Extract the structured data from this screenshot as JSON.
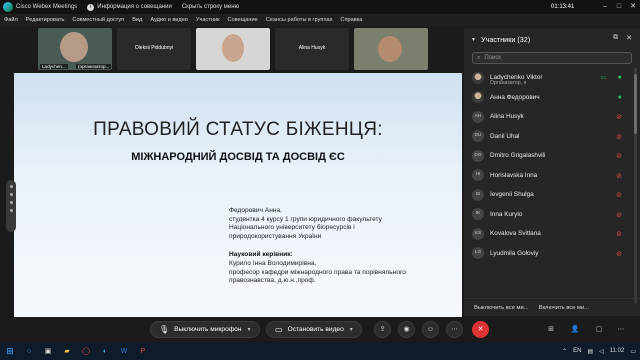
{
  "window": {
    "app_title": "Cisco Webex Meetings",
    "info_label": "Информация о совещании",
    "hide_menu_label": "Скрыть строку меню",
    "clock": "01:13:41"
  },
  "menu": [
    "Файл",
    "Редактировать",
    "Совместный доступ",
    "Вид",
    "Аудио и видео",
    "Участник",
    "Совещание",
    "Сеансы работы в группах",
    "Справка"
  ],
  "video_strip": {
    "tiles": [
      {
        "name": "Ladychen...",
        "org": "(организатор..."
      },
      {
        "name": "Oleksii Piddubnyi"
      },
      {
        "name": ""
      },
      {
        "name": "Alina Husyk"
      },
      {
        "name": ""
      }
    ]
  },
  "slide": {
    "title": "ПРАВОВИЙ СТАТУС БІЖЕНЦЯ:",
    "subtitle": "МІЖНАРОДНИЙ ДОСВІД ТА ДОСВІД ЄС",
    "author_lines": [
      "Федорович Анна,",
      "студентка 4 курсу 1 групи юридичного факультету",
      "Національного університету біоресурсів і",
      "природокористування України"
    ],
    "supervisor_label": "Науковий керівник:",
    "supervisor_lines": [
      "Курило Інна Володимирівна,",
      "професор кафедри міжнародного права та порівняльного",
      "правознавства, д.ю.н.,проф."
    ]
  },
  "participants": {
    "header": "Участники (32)",
    "search_placeholder": "Поиск",
    "list": [
      {
        "initials": "",
        "name": "Ladychenko Viktor",
        "role": "Организатор, я",
        "mic": "on",
        "photo": true
      },
      {
        "initials": "",
        "name": "Анна Федорович",
        "role": "",
        "mic": "on",
        "photo": true
      },
      {
        "initials": "AH",
        "name": "Alina Husyk",
        "role": "",
        "mic": "off"
      },
      {
        "initials": "DU",
        "name": "Danil Uhal",
        "role": "",
        "mic": "off"
      },
      {
        "initials": "DG",
        "name": "Dmitro Grigalashvili",
        "role": "",
        "mic": "off"
      },
      {
        "initials": "HI",
        "name": "Horislavska Inna",
        "role": "",
        "mic": "off"
      },
      {
        "initials": "IS",
        "name": "Ievgenii Shulga",
        "role": "",
        "mic": "off"
      },
      {
        "initials": "IK",
        "name": "Inna Kurylo",
        "role": "",
        "mic": "off"
      },
      {
        "initials": "KS",
        "name": "Kovalova Svitlana",
        "role": "",
        "mic": "off"
      },
      {
        "initials": "LG",
        "name": "Lyudmila Goloviy",
        "role": "",
        "mic": "off"
      }
    ],
    "footer": {
      "mute_all": "Выключить все ми...",
      "unmute_all": "Включить все ми..."
    }
  },
  "controls": {
    "mute_label": "Выключить микрофон",
    "video_label": "Остановить видео"
  },
  "tray": {
    "lang": "EN",
    "time": "11:02"
  }
}
